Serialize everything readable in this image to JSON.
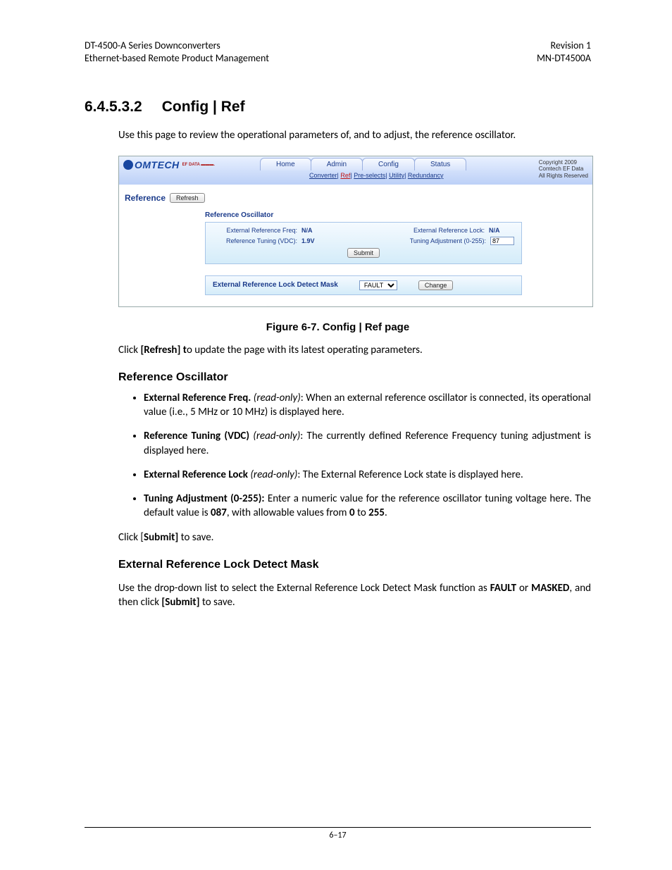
{
  "header": {
    "left1": "DT-4500-A Series Downconverters",
    "left2": "Ethernet-based Remote Product Management",
    "right1": "Revision 1",
    "right2": "MN-DT4500A"
  },
  "section": {
    "number": "6.4.5.3.2",
    "title": "Config | Ref",
    "intro": "Use this page to review the operational parameters of, and to adjust, the reference oscillator."
  },
  "screenshot": {
    "logo_main": "OMTECH",
    "logo_sub": "EF DATA ▬▬▬.",
    "tabs": {
      "home": "Home",
      "admin": "Admin",
      "config": "Config",
      "status": "Status"
    },
    "subnav": {
      "converter": "Converter",
      "ref": "Ref",
      "preselects": "Pre-selects",
      "utility": "Utility",
      "redundancy": "Redundancy",
      "sep": "| "
    },
    "copyright": {
      "l1": "Copyright 2009",
      "l2": "Comtech EF Data",
      "l3": "All Rights Reserved"
    },
    "reference_label": "Reference",
    "refresh": "Refresh",
    "panel1": {
      "title": "Reference Oscillator",
      "ext_ref_freq_lbl": "External Reference Freq:",
      "ext_ref_freq_val": "N/A",
      "ext_ref_lock_lbl": "External Reference Lock:",
      "ext_ref_lock_val": "N/A",
      "ref_tuning_lbl": "Reference Tuning (VDC):",
      "ref_tuning_val": "1.9V",
      "tuning_adj_lbl": "Tuning Adjustment (0-255):",
      "tuning_adj_val": "87",
      "submit": "Submit"
    },
    "panel2": {
      "title": "External Reference Lock Detect Mask",
      "select_value": "FAULT",
      "change": "Change"
    }
  },
  "figure_caption": "Figure 6-7. Config | Ref page",
  "body": {
    "click_refresh_pre": "Click ",
    "click_refresh_bold": "[Refresh] t",
    "click_refresh_post": "o update the page with its latest operating parameters.",
    "ref_osc_heading": "Reference Oscillator",
    "bullets": {
      "b1_bold": "External Reference Freq.",
      "b1_ital": " (read-only)",
      "b1_rest": ": When an external reference oscillator is connected, its operational value (i.e., 5 MHz or 10 MHz) is displayed here.",
      "b2_bold": "Reference Tuning (VDC)",
      "b2_ital": " (read-only)",
      "b2_rest": ": The currently defined Reference Frequency tuning adjustment is displayed here.",
      "b3_bold": "External Reference Lock",
      "b3_ital": " (read-only)",
      "b3_rest": ": The External Reference Lock state is displayed here.",
      "b4_bold": "Tuning Adjustment (0-255):",
      "b4_rest_a": " Enter a numeric value for the reference oscillator tuning voltage here. The default value is ",
      "b4_val": "087",
      "b4_rest_b": ", with allowable values from ",
      "b4_min": "0",
      "b4_rest_c": " to ",
      "b4_max": "255",
      "b4_rest_d": "."
    },
    "click_submit_pre": "Click [",
    "click_submit_bold": "Submit]",
    "click_submit_post": " to save.",
    "mask_heading": "External Reference Lock Detect Mask",
    "mask_p_a": "Use the drop-down list to select the External Reference Lock Detect Mask function as ",
    "mask_fault": "FAULT",
    "mask_p_b": " or ",
    "mask_masked": "MASKED",
    "mask_p_c": ", and then click ",
    "mask_submit": "[Submit]",
    "mask_p_d": " to save."
  },
  "footer": "6–17"
}
